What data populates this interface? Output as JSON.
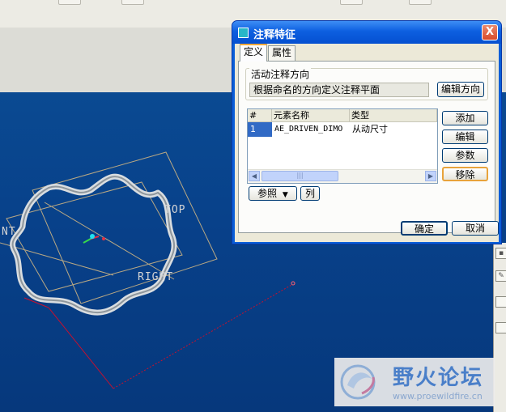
{
  "dialog": {
    "title": "注释特征",
    "close_glyph": "X",
    "tabs": [
      {
        "label": "定义",
        "active": true
      },
      {
        "label": "属性",
        "active": false
      }
    ],
    "active_direction": {
      "group_label": "活动注释方向",
      "value": "根据命名的方向定义注释平面",
      "edit_button": "编辑方向"
    },
    "table": {
      "headers": [
        "#",
        "元素名称",
        "类型"
      ],
      "rows": [
        {
          "index": "1",
          "name": "AE_DRIVEN_DIMO",
          "type": "从动尺寸",
          "selected": true
        }
      ]
    },
    "side_buttons": {
      "add": "添加",
      "edit": "编辑",
      "params": "参数",
      "remove": "移除"
    },
    "ref_button": "参照",
    "col_button": "列",
    "ok_button": "确定",
    "cancel_button": "取消"
  },
  "viewport": {
    "labels": {
      "top": "TOP",
      "right": "RIGHT",
      "front": "NT"
    }
  },
  "watermark": {
    "title": "野火论坛",
    "url": "www.proewildfire.cn"
  },
  "colors": {
    "viewport_bg": "#08418a",
    "titlebar": "#0550d0",
    "annotation_arrow": "#c8102e",
    "selection": "#316ac5"
  }
}
